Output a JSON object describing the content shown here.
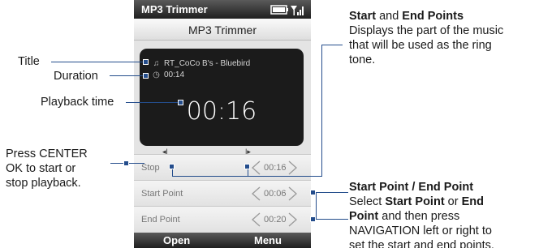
{
  "phone": {
    "status_bar": {
      "app_title": "MP3 Trimmer"
    },
    "title_bar": {
      "title": "MP3 Trimmer"
    },
    "player": {
      "song": "RT_CoCo B's - Bluebird",
      "duration": "00:14",
      "playback_time": "00:16"
    },
    "trim_bar": {
      "start_fraction": 0.18,
      "end_fraction": 0.67,
      "position_fraction": 0.53
    },
    "rows": [
      {
        "label": "Stop",
        "value": "00:16"
      },
      {
        "label": "Start Point",
        "value": "00:06"
      },
      {
        "label": "End Point",
        "value": "00:20"
      }
    ],
    "softkeys": {
      "left": "Open",
      "right": "Menu"
    }
  },
  "callouts": {
    "title": "Title",
    "duration": "Duration",
    "playback_time": "Playback time",
    "center_ok": [
      "Press CENTER",
      "OK to start or",
      "stop playback."
    ],
    "start_end_points": {
      "heading_a": "Start",
      "and": " and ",
      "heading_b": "End Points",
      "body": [
        "Displays the part of the music",
        "that will be used as the ring",
        "tone."
      ]
    },
    "point_select": {
      "heading": "Start Point / End Point",
      "select": "Select ",
      "start_point": "Start Point",
      "or": " or ",
      "end": "End",
      "point": "Point",
      "then": " and then press",
      "line3": "NAVIGATION left or right to",
      "line4": "set the start and end points."
    }
  },
  "colors": {
    "callout_line": "#244d8c",
    "status_bar": "#2a2a2a",
    "panel": "#1b1b1b"
  }
}
